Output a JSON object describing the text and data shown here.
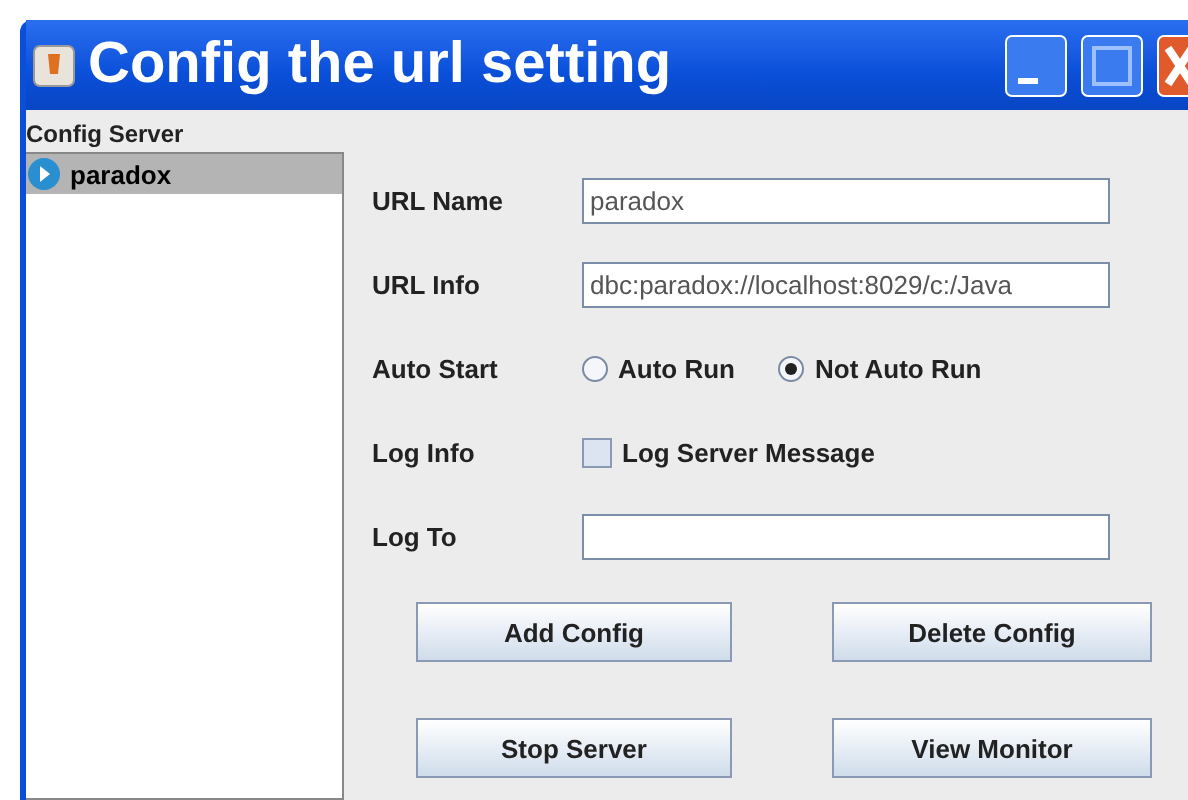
{
  "window": {
    "title": "Config the url setting"
  },
  "tree": {
    "title": "Config Server",
    "items": [
      {
        "label": "paradox",
        "selected": true
      }
    ]
  },
  "form": {
    "fields": [
      {
        "kind": "text",
        "label": "URL Name",
        "value": "paradox"
      },
      {
        "kind": "text",
        "label": "URL Info",
        "value": "dbc:paradox://localhost:8029/c:/Java"
      },
      {
        "kind": "radio",
        "label": "Auto Start",
        "options": [
          {
            "label": "Auto Run",
            "selected": false
          },
          {
            "label": "Not Auto Run",
            "selected": true
          }
        ]
      },
      {
        "kind": "checkbox",
        "label": "Log Info",
        "option": "Log Server Message",
        "checked": false
      },
      {
        "kind": "text",
        "label": "Log To"
      }
    ]
  },
  "buttons": [
    "Add Config",
    "Delete Config",
    "Stop Server",
    "View Monitor"
  ]
}
